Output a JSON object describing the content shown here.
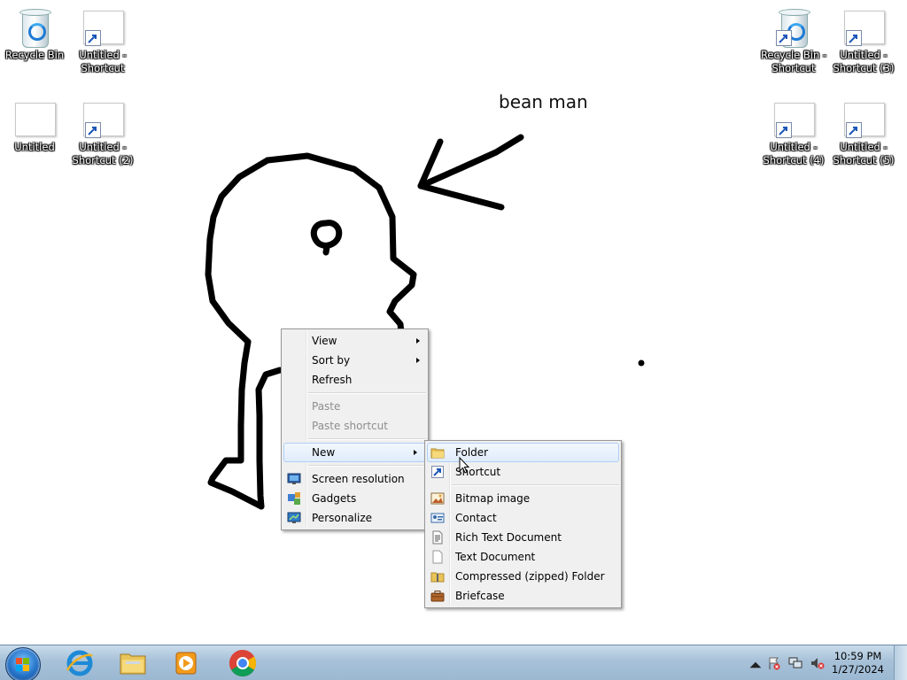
{
  "desktop": {
    "icons_left": [
      {
        "label": "Recycle Bin",
        "type": "recycle-bin"
      },
      {
        "label": "Untitled - Shortcut",
        "type": "paint-shortcut"
      },
      {
        "label": "Untitled",
        "type": "paint-file"
      },
      {
        "label": "Untitled - Shortcut (2)",
        "type": "paint-shortcut"
      }
    ],
    "icons_right": [
      {
        "label": "Recycle Bin - Shortcut",
        "type": "recycle-bin-shortcut"
      },
      {
        "label": "Untitled - Shortcut (3)",
        "type": "paint-shortcut"
      },
      {
        "label": "Untitled - Shortcut (4)",
        "type": "paint-shortcut"
      },
      {
        "label": "Untitled - Shortcut (5)",
        "type": "paint-shortcut"
      }
    ],
    "wallpaper_caption": "bean man"
  },
  "context_menu": {
    "items": [
      {
        "label": "View",
        "submenu": true,
        "enabled": true
      },
      {
        "label": "Sort by",
        "submenu": true,
        "enabled": true
      },
      {
        "label": "Refresh",
        "enabled": true
      },
      {
        "label": "Paste",
        "enabled": false
      },
      {
        "label": "Paste shortcut",
        "enabled": false
      },
      {
        "label": "New",
        "submenu": true,
        "enabled": true,
        "highlighted": true
      },
      {
        "label": "Screen resolution",
        "icon": "monitor-icon",
        "enabled": true
      },
      {
        "label": "Gadgets",
        "icon": "gadgets-icon",
        "enabled": true
      },
      {
        "label": "Personalize",
        "icon": "personalize-icon",
        "enabled": true
      }
    ]
  },
  "new_submenu": {
    "items": [
      {
        "label": "Folder",
        "icon": "folder-icon",
        "highlighted": true
      },
      {
        "label": "Shortcut",
        "icon": "shortcut-icon"
      },
      {
        "label": "Bitmap image",
        "icon": "bitmap-icon"
      },
      {
        "label": "Contact",
        "icon": "contact-icon"
      },
      {
        "label": "Rich Text Document",
        "icon": "rich-text-icon"
      },
      {
        "label": "Text Document",
        "icon": "text-document-icon"
      },
      {
        "label": "Compressed (zipped) Folder",
        "icon": "zip-folder-icon"
      },
      {
        "label": "Briefcase",
        "icon": "briefcase-icon"
      }
    ]
  },
  "taskbar": {
    "pinned": [
      "Internet Explorer",
      "Windows Explorer",
      "Windows Media Player",
      "Google Chrome"
    ],
    "clock": {
      "time": "10:59 PM",
      "date": "1/27/2024"
    }
  },
  "colors": {
    "accent": "#2371c7",
    "taskbar": "#a7c1d8",
    "menu_bg": "#f0f0f0"
  }
}
